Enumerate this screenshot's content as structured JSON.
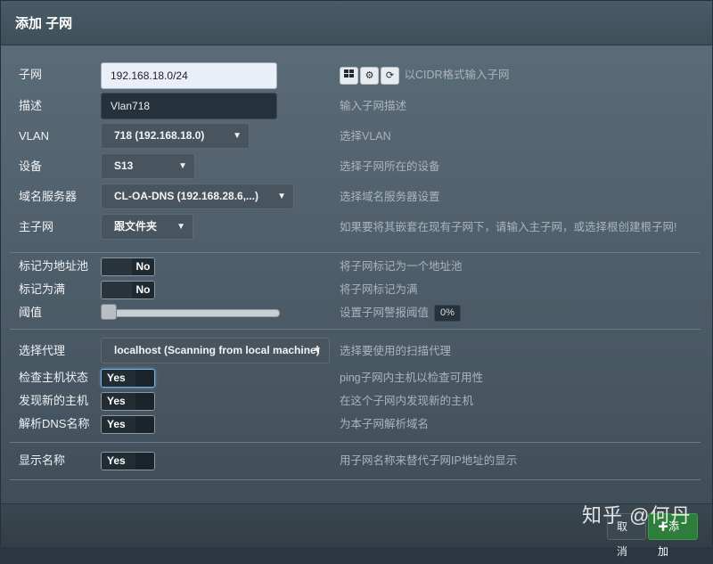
{
  "header": {
    "title": "添加 子网"
  },
  "fields": {
    "subnet": {
      "label": "子网",
      "value": "192.168.18.0/24",
      "help": "以CIDR格式输入子网"
    },
    "description": {
      "label": "描述",
      "value": "Vlan718",
      "help": "输入子网描述"
    },
    "vlan": {
      "label": "VLAN",
      "value": "718 (192.168.18.0)",
      "help": "选择VLAN"
    },
    "device": {
      "label": "设备",
      "value": "S13",
      "help": "选择子网所在的设备"
    },
    "dns": {
      "label": "域名服务器",
      "value": "CL-OA-DNS (192.168.28.6,...)",
      "help": "选择域名服务器设置"
    },
    "master": {
      "label": "主子网",
      "value": "跟文件夹",
      "help": "如果要将其嵌套在现有子网下，请输入主子网，或选择根创建根子网!"
    },
    "pool": {
      "label": "标记为地址池",
      "value": "No",
      "help": "将子网标记为一个地址池"
    },
    "full": {
      "label": "标记为满",
      "value": "No",
      "help": "将子网标记为满"
    },
    "threshold": {
      "label": "阈值",
      "value": "0%",
      "level": 0,
      "help": "设置子网警报阈值"
    },
    "agent": {
      "label": "选择代理",
      "value": "localhost (Scanning from local machine)",
      "help": "选择要使用的扫描代理"
    },
    "ping": {
      "label": "检查主机状态",
      "value": "Yes",
      "help": "ping子网内主机以检查可用性"
    },
    "discover": {
      "label": "发现新的主机",
      "value": "Yes",
      "help": "在这个子网内发现新的主机"
    },
    "resolve": {
      "label": "解析DNS名称",
      "value": "Yes",
      "help": "为本子网解析域名"
    },
    "shownames": {
      "label": "显示名称",
      "value": "Yes",
      "help": "用子网名称来替代子网IP地址的显示"
    }
  },
  "subnet_tools": [
    "grid-icon",
    "cogs-icon",
    "refresh-icon"
  ],
  "footer": {
    "cancel": "取消",
    "add": "添加"
  },
  "watermark": "知乎 @何丹",
  "colors": {
    "add_button": "#2e7d3a"
  }
}
